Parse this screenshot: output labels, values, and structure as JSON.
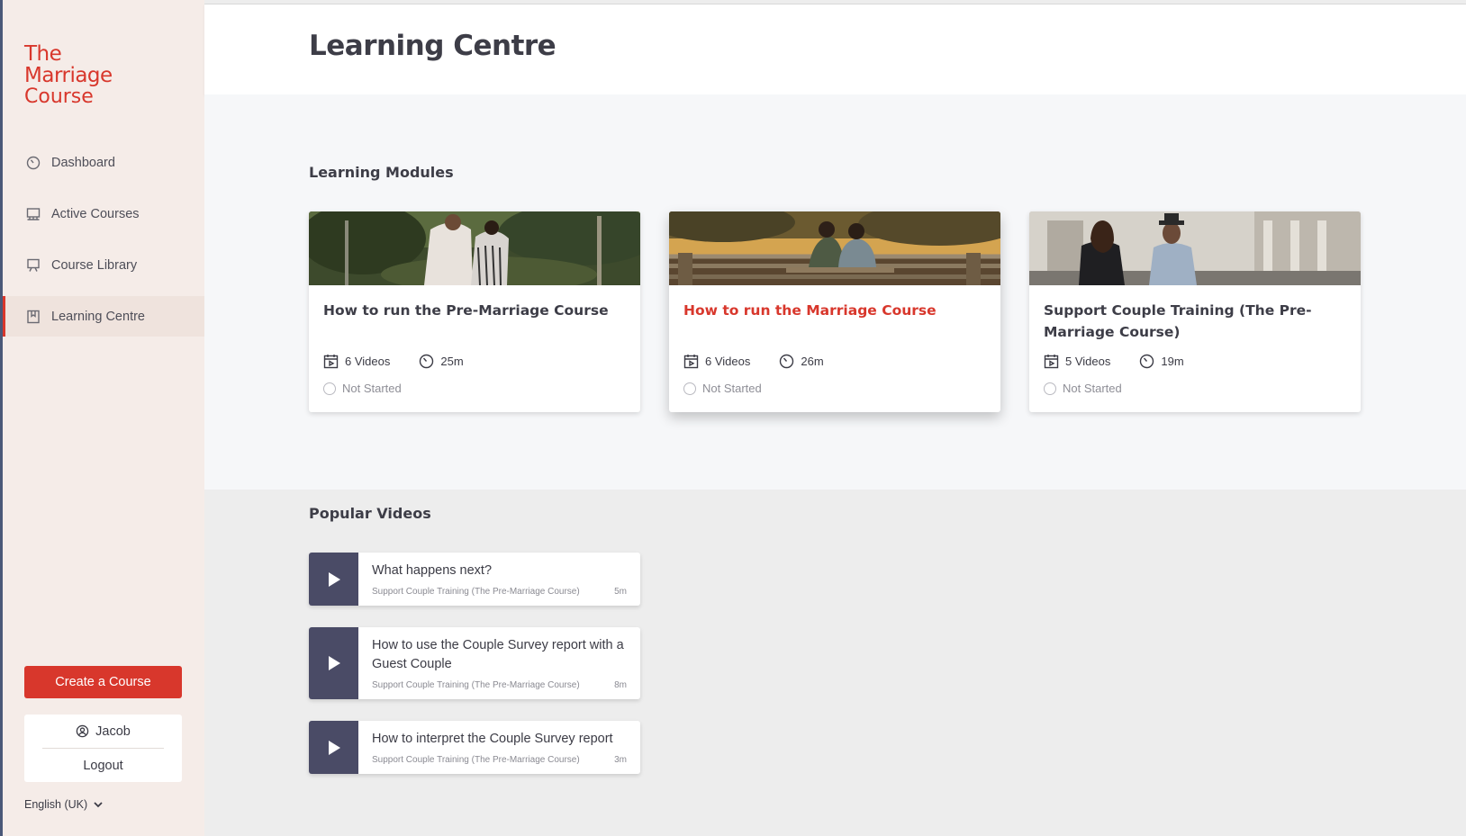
{
  "brand": {
    "line1": "The",
    "line2": "Marriage",
    "line3": "Course"
  },
  "nav": [
    {
      "label": "Dashboard",
      "icon": "dashboard-icon"
    },
    {
      "label": "Active Courses",
      "icon": "active-courses-icon"
    },
    {
      "label": "Course Library",
      "icon": "course-library-icon"
    },
    {
      "label": "Learning Centre",
      "icon": "learning-centre-icon",
      "active": true
    }
  ],
  "sidebar": {
    "create_label": "Create a Course",
    "user_name": "Jacob",
    "logout_label": "Logout",
    "language": "English (UK)"
  },
  "header": {
    "title": "Learning Centre"
  },
  "modules": {
    "heading": "Learning Modules",
    "items": [
      {
        "title": "How to run the Pre-Marriage Course",
        "videos": "6 Videos",
        "duration": "25m",
        "status": "Not Started"
      },
      {
        "title": "How to run the Marriage Course",
        "videos": "6 Videos",
        "duration": "26m",
        "status": "Not Started"
      },
      {
        "title": "Support Couple Training (The Pre-Marriage Course)",
        "videos": "5 Videos",
        "duration": "19m",
        "status": "Not Started"
      }
    ]
  },
  "popular": {
    "heading": "Popular Videos",
    "items": [
      {
        "title": "What happens next?",
        "course": "Support Couple Training (The Pre-Marriage Course)",
        "duration": "5m"
      },
      {
        "title": "How to use the Couple Survey report with a Guest Couple",
        "course": "Support Couple Training (The Pre-Marriage Course)",
        "duration": "8m"
      },
      {
        "title": "How to interpret the Couple Survey report",
        "course": "Support Couple Training (The Pre-Marriage Course)",
        "duration": "3m"
      }
    ]
  },
  "colors": {
    "accent": "#d8372c",
    "sidebar_bg": "#f5ece8",
    "play_bg": "#4a4b66"
  }
}
